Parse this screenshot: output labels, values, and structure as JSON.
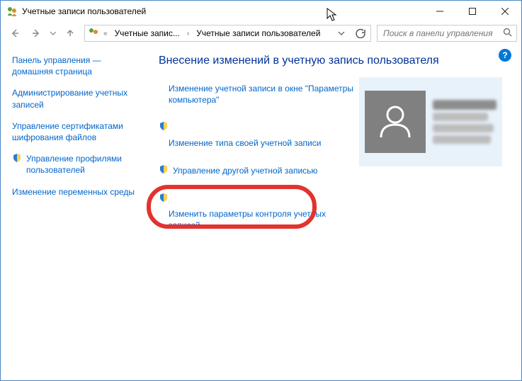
{
  "window": {
    "title": "Учетные записи пользователей",
    "minimize": "—",
    "maximize": "☐",
    "close": "✕"
  },
  "address": {
    "crumb1": "Учетные запис...",
    "crumb2": "Учетные записи пользователей"
  },
  "search": {
    "placeholder": "Поиск в панели управления"
  },
  "sidebar": {
    "items": [
      {
        "label": "Панель управления — домашняя страница",
        "shield": false
      },
      {
        "label": "Администрирование учетных записей",
        "shield": false
      },
      {
        "label": "Управление сертификатами шифрования файлов",
        "shield": false
      },
      {
        "label": "Управление профилями пользователей",
        "shield": true
      },
      {
        "label": "Изменение переменных среды",
        "shield": false
      }
    ]
  },
  "main": {
    "title": "Внесение изменений в учетную запись пользователя",
    "actions": [
      {
        "label": "Изменение учетной записи в окне \"Параметры компьютера\"",
        "shield": false,
        "inline": false
      },
      {
        "label": "Изменение типа своей учетной записи",
        "shield": true,
        "inline": false
      },
      {
        "label": "Управление другой учетной записью",
        "shield": true,
        "inline": true
      },
      {
        "label": "Изменить параметры контроля учетных записей",
        "shield": true,
        "inline": false
      }
    ]
  },
  "help": "?"
}
